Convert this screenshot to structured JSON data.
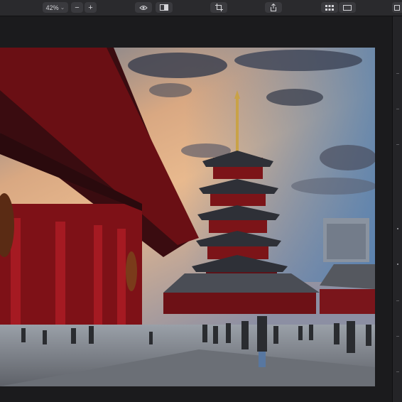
{
  "toolbar": {
    "zoom_level": "42%",
    "zoom_out_label": "−",
    "zoom_in_label": "+",
    "zoom_caret": "⌄"
  },
  "icons": {
    "zoom_dropdown": "chevron-down-icon",
    "preview": "eye-icon",
    "compare": "split-view-icon",
    "crop": "crop-icon",
    "share": "share-icon",
    "grid": "grid-icon",
    "single_view": "single-view-icon",
    "panel_toggle": "sidebar-toggle-icon"
  },
  "photo": {
    "subject": "Pagoda photo"
  },
  "colors": {
    "toolbar_bg": "#2a2a2d",
    "canvas_bg": "#1b1b1d",
    "button_bg": "#3a3a3e"
  }
}
